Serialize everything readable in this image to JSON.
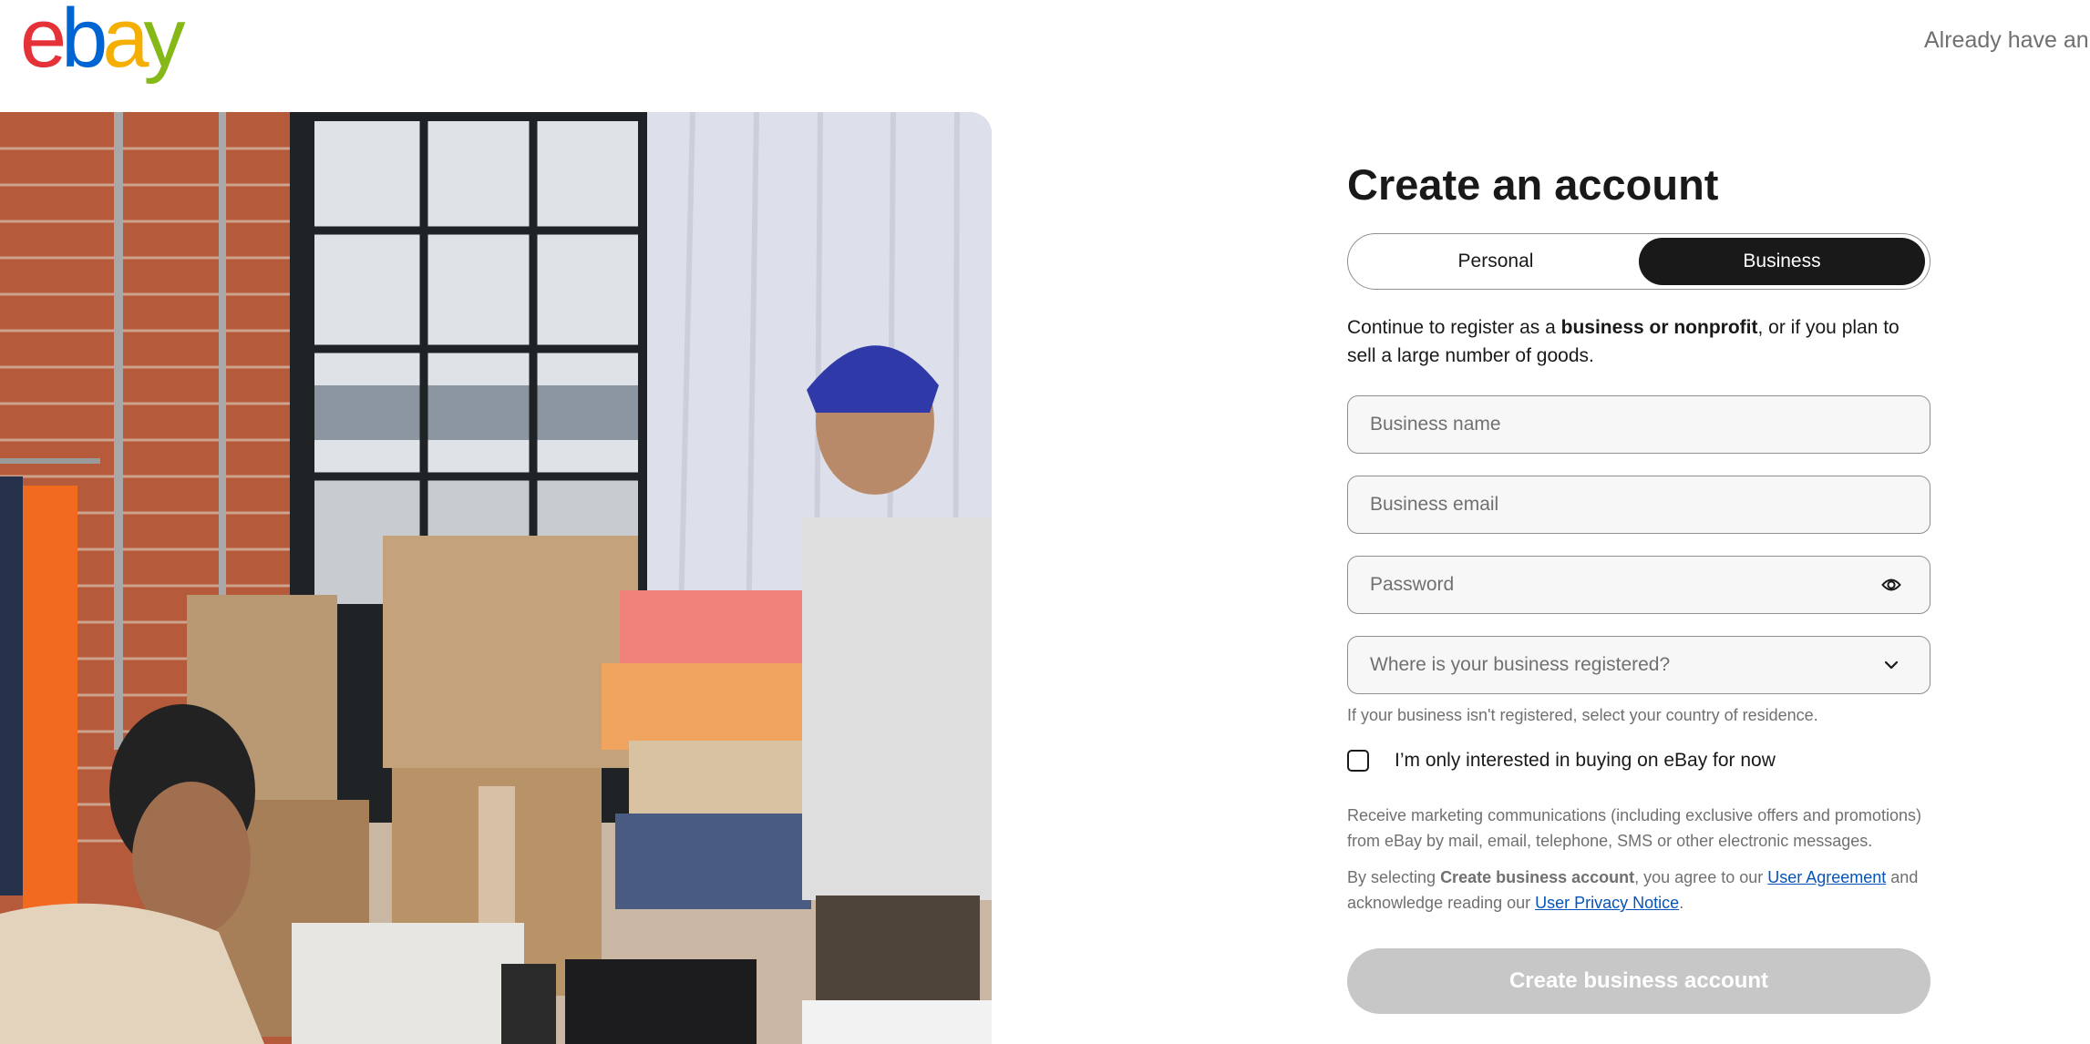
{
  "header": {
    "logo": {
      "letters": [
        "e",
        "b",
        "a",
        "y"
      ],
      "colors": [
        "#e53238",
        "#0064d2",
        "#f5af02",
        "#86b817"
      ],
      "alt": "eBay"
    },
    "signin_prompt": "Already have an"
  },
  "hero": {
    "description": "Photo of two people packing cardboard boxes and shoe boxes in a brick-walled workspace"
  },
  "form": {
    "title": "Create an account",
    "account_type_tabs": [
      {
        "label": "Personal",
        "selected": false
      },
      {
        "label": "Business",
        "selected": true
      }
    ],
    "description": {
      "before": "Continue to register as a ",
      "bold": "business or nonprofit",
      "after": ", or if you plan to sell a large number of goods."
    },
    "fields": {
      "business_name": {
        "placeholder": "Business name",
        "value": ""
      },
      "business_email": {
        "placeholder": "Business email",
        "value": ""
      },
      "password": {
        "placeholder": "Password",
        "value": "",
        "icon": "eye-icon"
      },
      "country": {
        "placeholder": "Where is your business registered?",
        "icon": "chevron-down-icon"
      }
    },
    "country_helper": "If your business isn't registered, select your country of residence.",
    "buying_only_checkbox": {
      "label": "I’m only interested in buying on eBay for now",
      "checked": false
    },
    "marketing_text": "Receive marketing communications (including exclusive offers and promotions) from eBay by mail, email, telephone, SMS or other electronic messages.",
    "agreement": {
      "prefix": "By selecting ",
      "bold": "Create business account",
      "middle": ", you agree to our ",
      "link1": "User Agreement",
      "connector": " and acknowledge reading our ",
      "link2": "User Privacy Notice",
      "suffix": "."
    },
    "submit_label": "Create business account",
    "submit_enabled": false
  },
  "colors": {
    "text_primary": "#191919",
    "text_secondary": "#707070",
    "link": "#0654ba",
    "button_disabled": "#c7c7c7",
    "field_bg": "#f7f7f7"
  }
}
